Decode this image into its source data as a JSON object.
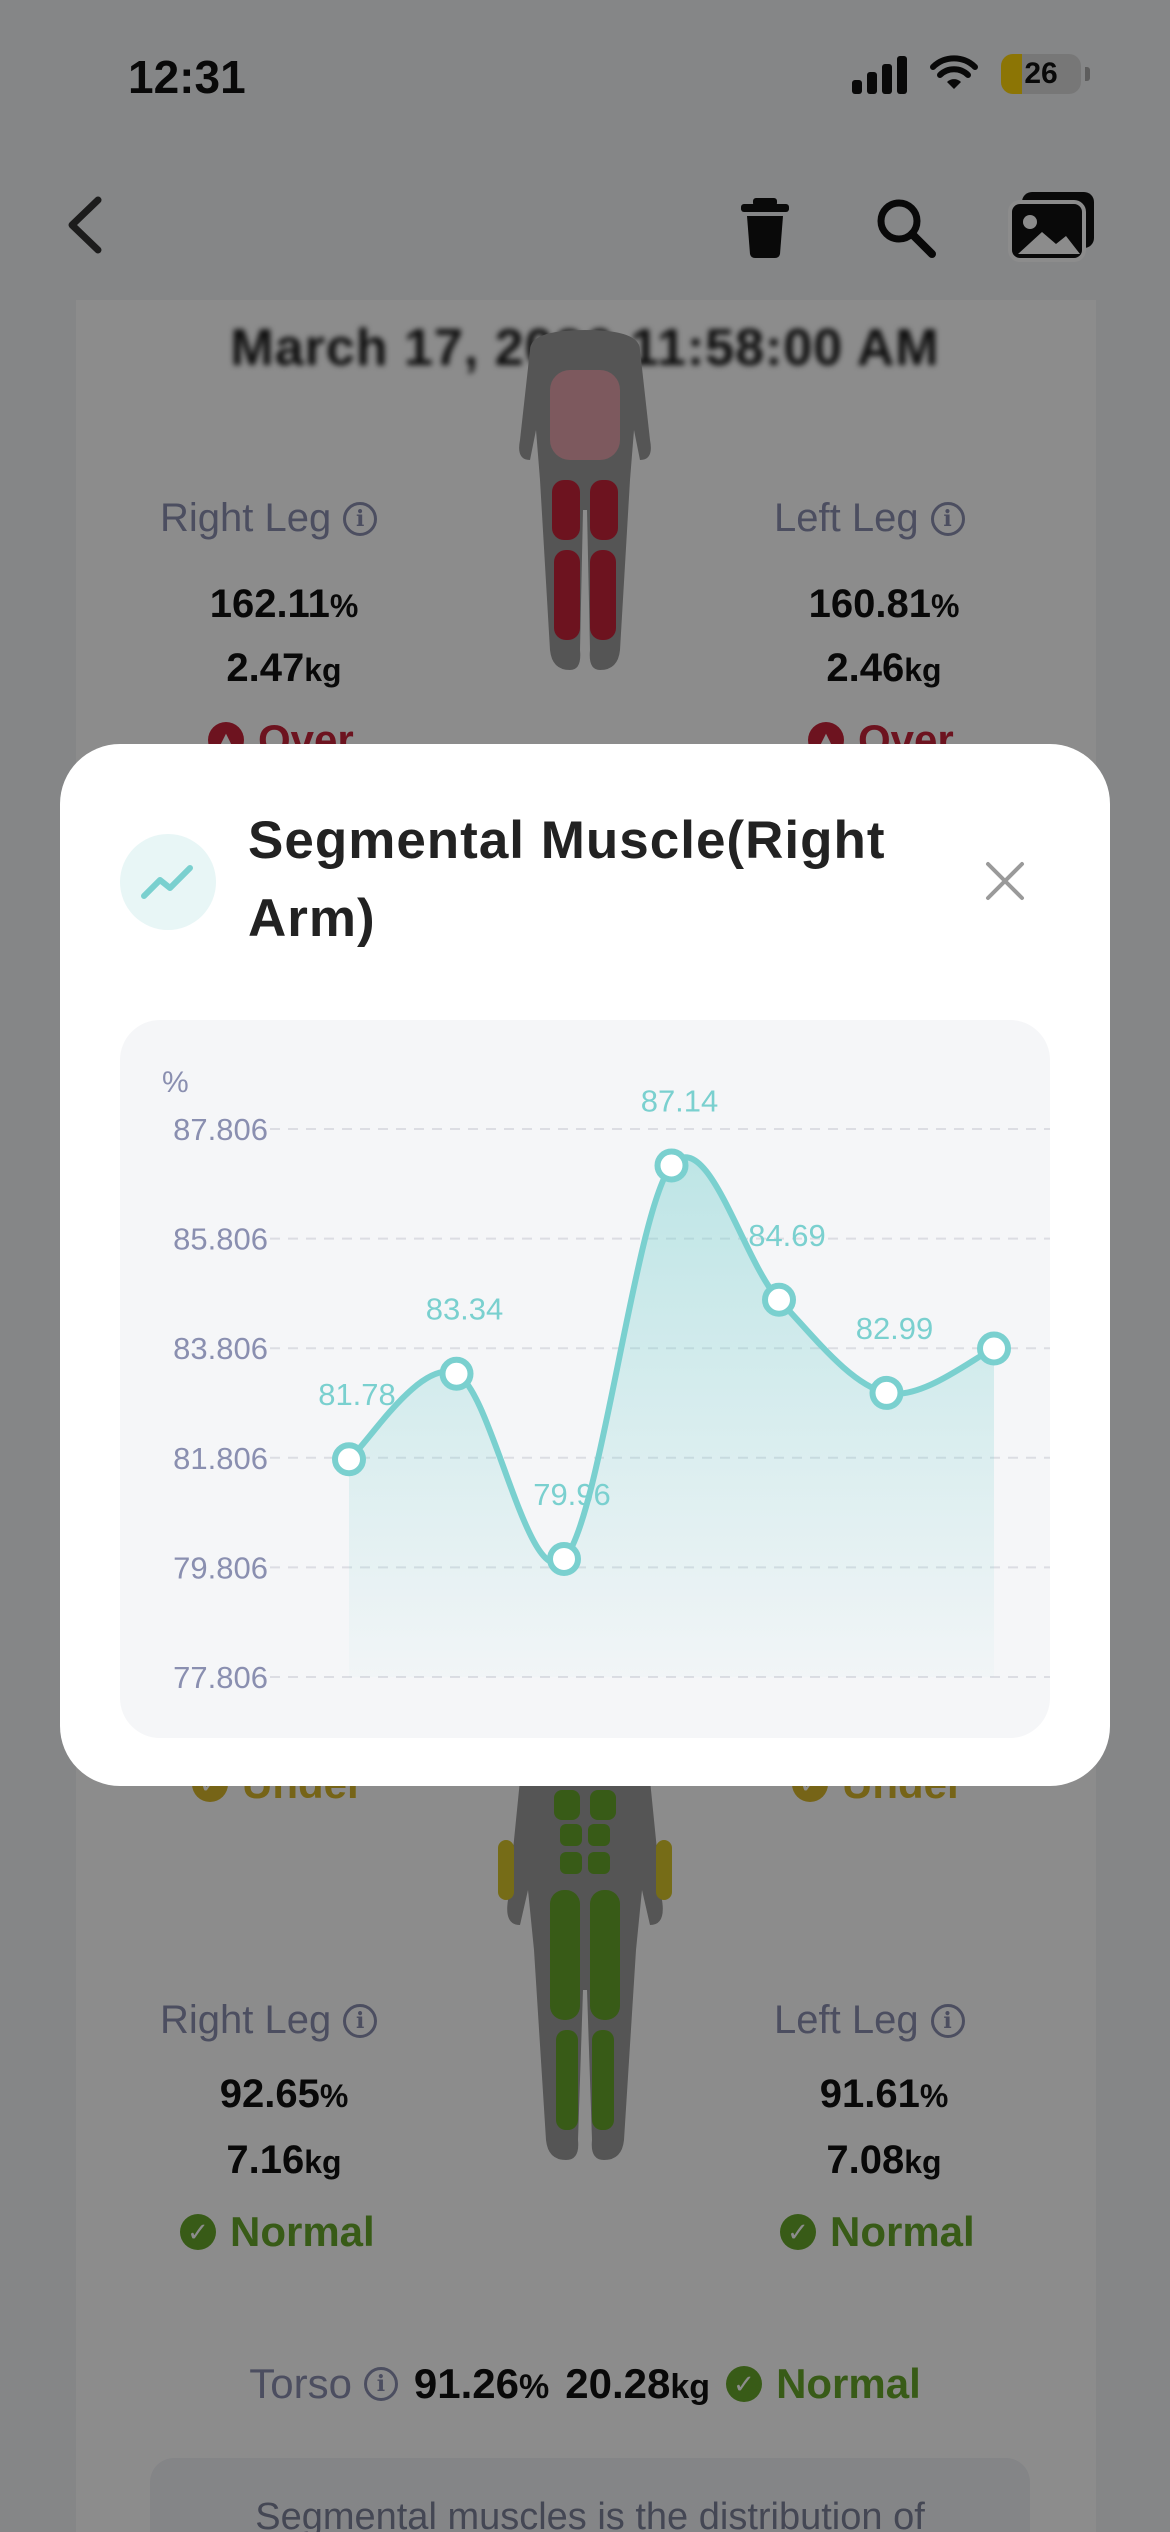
{
  "status_bar": {
    "time": "12:31",
    "battery": "26"
  },
  "page": {
    "date": "March 17, 2026 11:58:00 AM",
    "fat_section": {
      "right_leg": {
        "label": "Right Leg",
        "percent": "162.11",
        "weight": "2.47",
        "status": "Over"
      },
      "left_leg": {
        "label": "Left Leg",
        "percent": "160.81",
        "weight": "2.46",
        "status": "Over"
      }
    },
    "muscle_section": {
      "right_arm_status": "Under",
      "left_arm_status": "Under",
      "right_leg": {
        "label": "Right Leg",
        "percent": "92.65",
        "weight": "7.16",
        "status": "Normal"
      },
      "left_leg": {
        "label": "Left Leg",
        "percent": "91.61",
        "weight": "7.08",
        "status": "Normal"
      },
      "torso": {
        "label": "Torso",
        "percent": "91.26",
        "weight": "20.28",
        "status": "Normal"
      }
    },
    "units": {
      "percent": "%",
      "kg": "kg"
    },
    "description": "Segmental muscles is the distribution of"
  },
  "modal": {
    "title": "Segmental Muscle(Right Arm)",
    "icon": "trend-chart-icon",
    "close_icon": "close-icon"
  },
  "colors": {
    "accent": "#7ad0cf",
    "over": "#c7243a",
    "normal": "#66a62a",
    "under": "#d8b72a"
  },
  "chart_data": {
    "type": "line",
    "ylabel": "%",
    "y_ticks": [
      87.806,
      85.806,
      83.806,
      81.806,
      79.806,
      77.806
    ],
    "ylim": [
      77.806,
      87.806
    ],
    "values": [
      81.78,
      83.34,
      79.96,
      87.14,
      84.69,
      82.99,
      null
    ],
    "end_value": 83.8,
    "data_labels": [
      "81.78",
      "83.34",
      "79.96",
      "87.14",
      "84.69",
      "82.99"
    ],
    "smooth": true,
    "area_fill": true,
    "grid": "horizontal-dashed"
  }
}
